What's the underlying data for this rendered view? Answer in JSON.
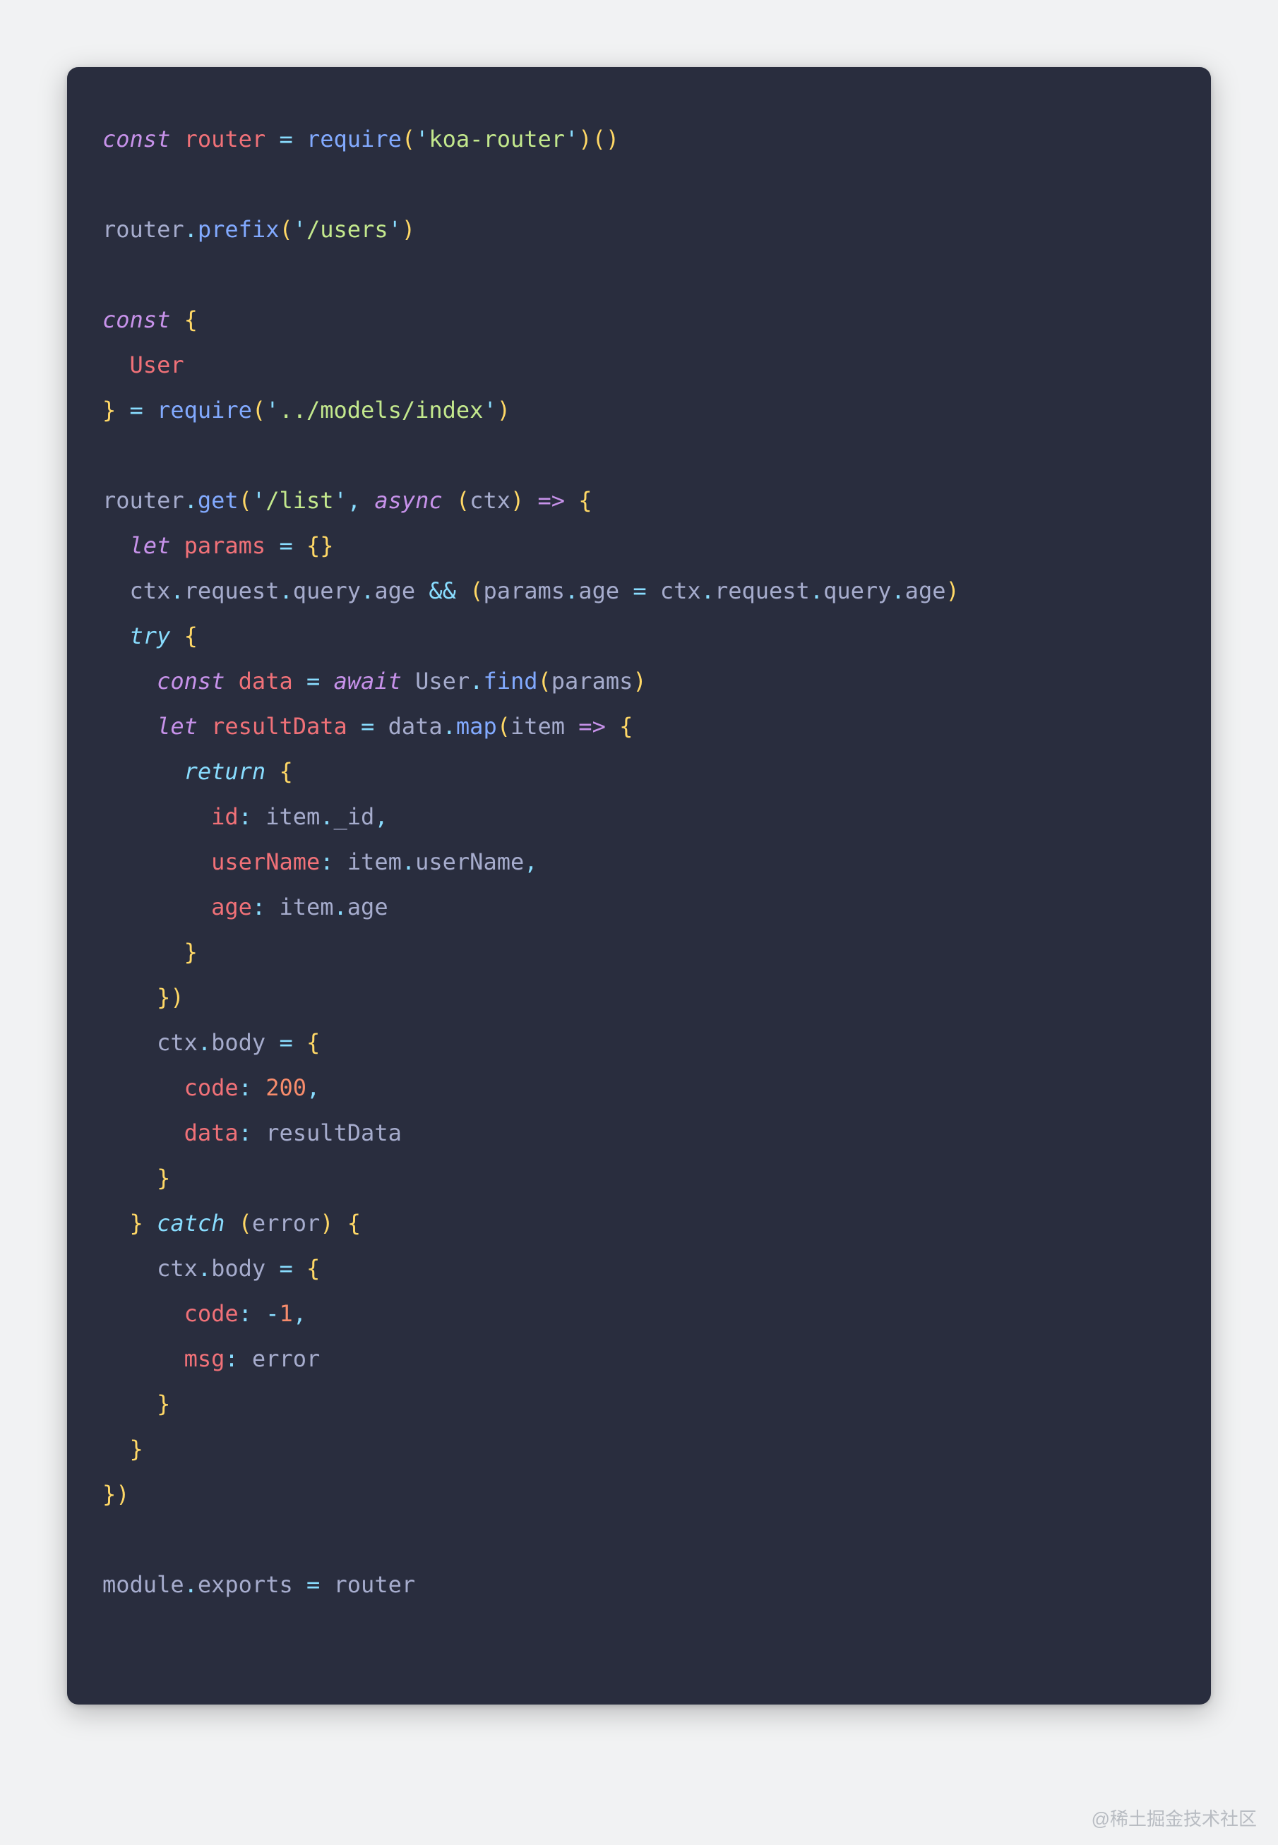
{
  "code": {
    "lines": [
      [
        {
          "cls": "kw-decl",
          "t": "const"
        },
        {
          "cls": "plain",
          "t": " "
        },
        {
          "cls": "ident",
          "t": "router"
        },
        {
          "cls": "plain",
          "t": " "
        },
        {
          "cls": "op",
          "t": "="
        },
        {
          "cls": "plain",
          "t": " "
        },
        {
          "cls": "fn",
          "t": "require"
        },
        {
          "cls": "paren",
          "t": "("
        },
        {
          "cls": "op",
          "t": "'"
        },
        {
          "cls": "str",
          "t": "koa-router"
        },
        {
          "cls": "op",
          "t": "'"
        },
        {
          "cls": "paren",
          "t": ")()"
        }
      ],
      [],
      [
        {
          "cls": "obj",
          "t": "router"
        },
        {
          "cls": "op",
          "t": "."
        },
        {
          "cls": "fn",
          "t": "prefix"
        },
        {
          "cls": "paren",
          "t": "("
        },
        {
          "cls": "op",
          "t": "'"
        },
        {
          "cls": "str",
          "t": "/users"
        },
        {
          "cls": "op",
          "t": "'"
        },
        {
          "cls": "paren",
          "t": ")"
        }
      ],
      [],
      [
        {
          "cls": "kw-decl",
          "t": "const"
        },
        {
          "cls": "plain",
          "t": " "
        },
        {
          "cls": "paren",
          "t": "{"
        }
      ],
      [
        {
          "cls": "plain",
          "t": "  "
        },
        {
          "cls": "ident",
          "t": "User"
        }
      ],
      [
        {
          "cls": "paren",
          "t": "}"
        },
        {
          "cls": "plain",
          "t": " "
        },
        {
          "cls": "op",
          "t": "="
        },
        {
          "cls": "plain",
          "t": " "
        },
        {
          "cls": "fn",
          "t": "require"
        },
        {
          "cls": "paren",
          "t": "("
        },
        {
          "cls": "op",
          "t": "'"
        },
        {
          "cls": "str",
          "t": "../models/index"
        },
        {
          "cls": "op",
          "t": "'"
        },
        {
          "cls": "paren",
          "t": ")"
        }
      ],
      [],
      [
        {
          "cls": "obj",
          "t": "router"
        },
        {
          "cls": "op",
          "t": "."
        },
        {
          "cls": "fn",
          "t": "get"
        },
        {
          "cls": "paren",
          "t": "("
        },
        {
          "cls": "op",
          "t": "'"
        },
        {
          "cls": "str",
          "t": "/list"
        },
        {
          "cls": "op",
          "t": "'"
        },
        {
          "cls": "op",
          "t": ","
        },
        {
          "cls": "plain",
          "t": " "
        },
        {
          "cls": "kw-async",
          "t": "async"
        },
        {
          "cls": "plain",
          "t": " "
        },
        {
          "cls": "paren",
          "t": "("
        },
        {
          "cls": "obj",
          "t": "ctx"
        },
        {
          "cls": "paren",
          "t": ")"
        },
        {
          "cls": "plain",
          "t": " "
        },
        {
          "cls": "arrow",
          "t": "=>"
        },
        {
          "cls": "plain",
          "t": " "
        },
        {
          "cls": "paren",
          "t": "{"
        }
      ],
      [
        {
          "cls": "plain",
          "t": "  "
        },
        {
          "cls": "kw-decl",
          "t": "let"
        },
        {
          "cls": "plain",
          "t": " "
        },
        {
          "cls": "ident",
          "t": "params"
        },
        {
          "cls": "plain",
          "t": " "
        },
        {
          "cls": "op",
          "t": "="
        },
        {
          "cls": "plain",
          "t": " "
        },
        {
          "cls": "paren",
          "t": "{}"
        }
      ],
      [
        {
          "cls": "plain",
          "t": "  "
        },
        {
          "cls": "obj",
          "t": "ctx"
        },
        {
          "cls": "op",
          "t": "."
        },
        {
          "cls": "prop",
          "t": "request"
        },
        {
          "cls": "op",
          "t": "."
        },
        {
          "cls": "prop",
          "t": "query"
        },
        {
          "cls": "op",
          "t": "."
        },
        {
          "cls": "prop",
          "t": "age"
        },
        {
          "cls": "plain",
          "t": " "
        },
        {
          "cls": "op",
          "t": "&&"
        },
        {
          "cls": "plain",
          "t": " "
        },
        {
          "cls": "paren",
          "t": "("
        },
        {
          "cls": "obj",
          "t": "params"
        },
        {
          "cls": "op",
          "t": "."
        },
        {
          "cls": "prop",
          "t": "age"
        },
        {
          "cls": "plain",
          "t": " "
        },
        {
          "cls": "op",
          "t": "="
        },
        {
          "cls": "plain",
          "t": " "
        },
        {
          "cls": "obj",
          "t": "ctx"
        },
        {
          "cls": "op",
          "t": "."
        },
        {
          "cls": "prop",
          "t": "request"
        },
        {
          "cls": "op",
          "t": "."
        },
        {
          "cls": "prop",
          "t": "query"
        },
        {
          "cls": "op",
          "t": "."
        },
        {
          "cls": "prop",
          "t": "age"
        },
        {
          "cls": "paren",
          "t": ")"
        }
      ],
      [
        {
          "cls": "plain",
          "t": "  "
        },
        {
          "cls": "kw-flow",
          "t": "try"
        },
        {
          "cls": "plain",
          "t": " "
        },
        {
          "cls": "paren",
          "t": "{"
        }
      ],
      [
        {
          "cls": "plain",
          "t": "    "
        },
        {
          "cls": "kw-decl",
          "t": "const"
        },
        {
          "cls": "plain",
          "t": " "
        },
        {
          "cls": "ident",
          "t": "data"
        },
        {
          "cls": "plain",
          "t": " "
        },
        {
          "cls": "op",
          "t": "="
        },
        {
          "cls": "plain",
          "t": " "
        },
        {
          "cls": "kw-await",
          "t": "await"
        },
        {
          "cls": "plain",
          "t": " "
        },
        {
          "cls": "obj",
          "t": "User"
        },
        {
          "cls": "op",
          "t": "."
        },
        {
          "cls": "fn",
          "t": "find"
        },
        {
          "cls": "paren",
          "t": "("
        },
        {
          "cls": "obj",
          "t": "params"
        },
        {
          "cls": "paren",
          "t": ")"
        }
      ],
      [
        {
          "cls": "plain",
          "t": "    "
        },
        {
          "cls": "kw-decl",
          "t": "let"
        },
        {
          "cls": "plain",
          "t": " "
        },
        {
          "cls": "ident",
          "t": "resultData"
        },
        {
          "cls": "plain",
          "t": " "
        },
        {
          "cls": "op",
          "t": "="
        },
        {
          "cls": "plain",
          "t": " "
        },
        {
          "cls": "obj",
          "t": "data"
        },
        {
          "cls": "op",
          "t": "."
        },
        {
          "cls": "fn",
          "t": "map"
        },
        {
          "cls": "paren",
          "t": "("
        },
        {
          "cls": "obj",
          "t": "item"
        },
        {
          "cls": "plain",
          "t": " "
        },
        {
          "cls": "arrow",
          "t": "=>"
        },
        {
          "cls": "plain",
          "t": " "
        },
        {
          "cls": "paren",
          "t": "{"
        }
      ],
      [
        {
          "cls": "plain",
          "t": "      "
        },
        {
          "cls": "kw-flow",
          "t": "return"
        },
        {
          "cls": "plain",
          "t": " "
        },
        {
          "cls": "paren",
          "t": "{"
        }
      ],
      [
        {
          "cls": "plain",
          "t": "        "
        },
        {
          "cls": "ident",
          "t": "id"
        },
        {
          "cls": "op",
          "t": ":"
        },
        {
          "cls": "plain",
          "t": " "
        },
        {
          "cls": "obj",
          "t": "item"
        },
        {
          "cls": "op",
          "t": "."
        },
        {
          "cls": "prop",
          "t": "_id"
        },
        {
          "cls": "op",
          "t": ","
        }
      ],
      [
        {
          "cls": "plain",
          "t": "        "
        },
        {
          "cls": "ident",
          "t": "userName"
        },
        {
          "cls": "op",
          "t": ":"
        },
        {
          "cls": "plain",
          "t": " "
        },
        {
          "cls": "obj",
          "t": "item"
        },
        {
          "cls": "op",
          "t": "."
        },
        {
          "cls": "prop",
          "t": "userName"
        },
        {
          "cls": "op",
          "t": ","
        }
      ],
      [
        {
          "cls": "plain",
          "t": "        "
        },
        {
          "cls": "ident",
          "t": "age"
        },
        {
          "cls": "op",
          "t": ":"
        },
        {
          "cls": "plain",
          "t": " "
        },
        {
          "cls": "obj",
          "t": "item"
        },
        {
          "cls": "op",
          "t": "."
        },
        {
          "cls": "prop",
          "t": "age"
        }
      ],
      [
        {
          "cls": "plain",
          "t": "      "
        },
        {
          "cls": "paren",
          "t": "}"
        }
      ],
      [
        {
          "cls": "plain",
          "t": "    "
        },
        {
          "cls": "paren",
          "t": "})"
        }
      ],
      [
        {
          "cls": "plain",
          "t": "    "
        },
        {
          "cls": "obj",
          "t": "ctx"
        },
        {
          "cls": "op",
          "t": "."
        },
        {
          "cls": "prop",
          "t": "body"
        },
        {
          "cls": "plain",
          "t": " "
        },
        {
          "cls": "op",
          "t": "="
        },
        {
          "cls": "plain",
          "t": " "
        },
        {
          "cls": "paren",
          "t": "{"
        }
      ],
      [
        {
          "cls": "plain",
          "t": "      "
        },
        {
          "cls": "ident",
          "t": "code"
        },
        {
          "cls": "op",
          "t": ":"
        },
        {
          "cls": "plain",
          "t": " "
        },
        {
          "cls": "num",
          "t": "200"
        },
        {
          "cls": "op",
          "t": ","
        }
      ],
      [
        {
          "cls": "plain",
          "t": "      "
        },
        {
          "cls": "ident",
          "t": "data"
        },
        {
          "cls": "op",
          "t": ":"
        },
        {
          "cls": "plain",
          "t": " "
        },
        {
          "cls": "obj",
          "t": "resultData"
        }
      ],
      [
        {
          "cls": "plain",
          "t": "    "
        },
        {
          "cls": "paren",
          "t": "}"
        }
      ],
      [
        {
          "cls": "plain",
          "t": "  "
        },
        {
          "cls": "paren",
          "t": "}"
        },
        {
          "cls": "plain",
          "t": " "
        },
        {
          "cls": "kw-flow",
          "t": "catch"
        },
        {
          "cls": "plain",
          "t": " "
        },
        {
          "cls": "paren",
          "t": "("
        },
        {
          "cls": "obj",
          "t": "error"
        },
        {
          "cls": "paren",
          "t": ")"
        },
        {
          "cls": "plain",
          "t": " "
        },
        {
          "cls": "paren",
          "t": "{"
        }
      ],
      [
        {
          "cls": "plain",
          "t": "    "
        },
        {
          "cls": "obj",
          "t": "ctx"
        },
        {
          "cls": "op",
          "t": "."
        },
        {
          "cls": "prop",
          "t": "body"
        },
        {
          "cls": "plain",
          "t": " "
        },
        {
          "cls": "op",
          "t": "="
        },
        {
          "cls": "plain",
          "t": " "
        },
        {
          "cls": "paren",
          "t": "{"
        }
      ],
      [
        {
          "cls": "plain",
          "t": "      "
        },
        {
          "cls": "ident",
          "t": "code"
        },
        {
          "cls": "op",
          "t": ":"
        },
        {
          "cls": "plain",
          "t": " "
        },
        {
          "cls": "op",
          "t": "-"
        },
        {
          "cls": "num",
          "t": "1"
        },
        {
          "cls": "op",
          "t": ","
        }
      ],
      [
        {
          "cls": "plain",
          "t": "      "
        },
        {
          "cls": "ident",
          "t": "msg"
        },
        {
          "cls": "op",
          "t": ":"
        },
        {
          "cls": "plain",
          "t": " "
        },
        {
          "cls": "obj",
          "t": "error"
        }
      ],
      [
        {
          "cls": "plain",
          "t": "    "
        },
        {
          "cls": "paren",
          "t": "}"
        }
      ],
      [
        {
          "cls": "plain",
          "t": "  "
        },
        {
          "cls": "paren",
          "t": "}"
        }
      ],
      [
        {
          "cls": "paren",
          "t": "})"
        }
      ],
      [],
      [
        {
          "cls": "obj",
          "t": "module"
        },
        {
          "cls": "op",
          "t": "."
        },
        {
          "cls": "prop",
          "t": "exports"
        },
        {
          "cls": "plain",
          "t": " "
        },
        {
          "cls": "op",
          "t": "="
        },
        {
          "cls": "plain",
          "t": " "
        },
        {
          "cls": "obj",
          "t": "router"
        }
      ]
    ]
  },
  "watermark": "@稀土掘金技术社区"
}
